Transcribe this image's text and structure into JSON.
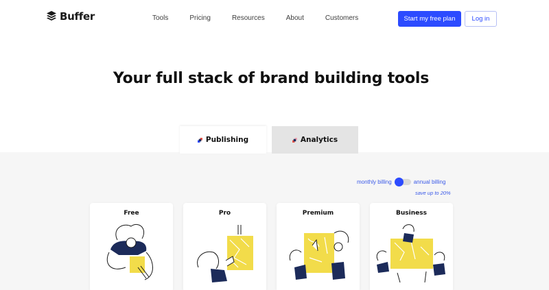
{
  "nav": {
    "logo_text": "Buffer",
    "links": [
      "Tools",
      "Pricing",
      "Resources",
      "About",
      "Customers"
    ],
    "cta_primary": "Start my free plan",
    "cta_secondary": "Log in"
  },
  "hero": {
    "title": "Your full stack of brand building tools"
  },
  "tabs": [
    {
      "label": "Publishing",
      "active": true,
      "icon": "publishing-icon"
    },
    {
      "label": "Analytics",
      "active": false,
      "icon": "analytics-icon"
    }
  ],
  "billing": {
    "monthly_label": "monthly billing",
    "annual_label": "annual billing",
    "save_note": "save up to 20%"
  },
  "plans": [
    {
      "name": "Free"
    },
    {
      "name": "Pro"
    },
    {
      "name": "Premium"
    },
    {
      "name": "Business"
    }
  ],
  "colors": {
    "accent": "#2c4bff",
    "illustration_yellow": "#f2dc4a",
    "illustration_navy": "#1c2b5a"
  }
}
